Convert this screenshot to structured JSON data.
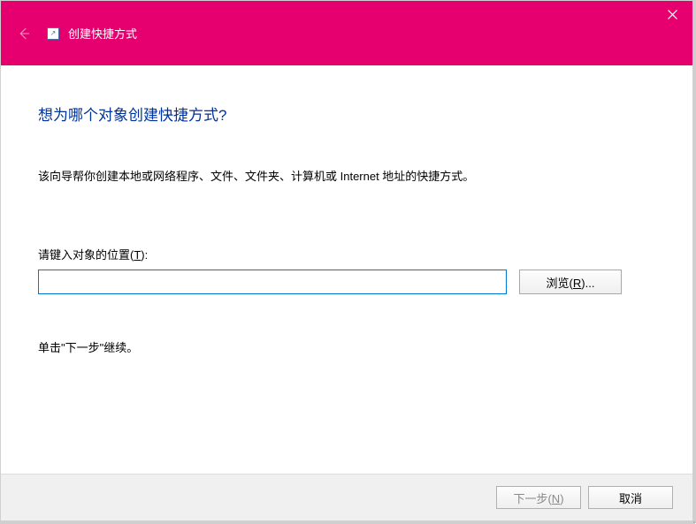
{
  "titlebar": {
    "title": "创建快捷方式"
  },
  "content": {
    "heading": "想为哪个对象创建快捷方式?",
    "description": "该向导帮你创建本地或网络程序、文件、文件夹、计算机或 Internet 地址的快捷方式。",
    "input_label_prefix": "请键入对象的位置(",
    "input_label_accel": "T",
    "input_label_suffix": "):",
    "input_value": "",
    "browse_label_prefix": "浏览(",
    "browse_label_accel": "R",
    "browse_label_suffix": ")...",
    "continue_text": "单击\"下一步\"继续。"
  },
  "footer": {
    "next_prefix": "下一步(",
    "next_accel": "N",
    "next_suffix": ")",
    "cancel_label": "取消"
  }
}
